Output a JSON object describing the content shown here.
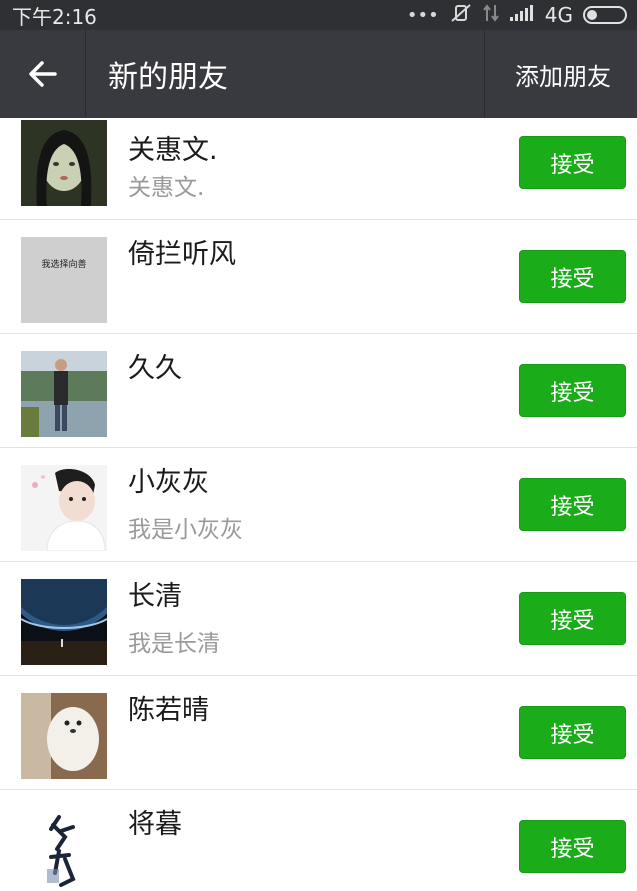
{
  "status_bar": {
    "time": "下午2:16",
    "network": "4G",
    "icons": [
      "dots-icon",
      "mute-vibrate-icon",
      "data-arrows-icon",
      "signal-icon",
      "battery-icon"
    ]
  },
  "nav": {
    "title": "新的朋友",
    "action": "添加朋友",
    "back_icon": "back-arrow-icon"
  },
  "colors": {
    "nav_bg": "#393a3f",
    "status_bg": "#2f3033",
    "accept_green": "#1aad19"
  },
  "requests": [
    {
      "name": "关惠文.",
      "message": "关惠文.",
      "button": "接受",
      "avatar": "avatar-portrait-girl"
    },
    {
      "name": "倚拦听风",
      "message": "",
      "button": "接受",
      "avatar": "avatar-gray-text",
      "avatar_text": "我选择向善"
    },
    {
      "name": "久久",
      "message": "",
      "button": "接受",
      "avatar": "avatar-person-outdoor"
    },
    {
      "name": "小灰灰",
      "message": "我是小灰灰",
      "button": "接受",
      "avatar": "avatar-boy-cartoon"
    },
    {
      "name": "长清",
      "message": "我是长清",
      "button": "接受",
      "avatar": "avatar-earth-space"
    },
    {
      "name": "陈若晴",
      "message": "",
      "button": "接受",
      "avatar": "avatar-white-dog"
    },
    {
      "name": "将暮",
      "message": "",
      "button": "接受",
      "avatar": "avatar-calligraphy"
    }
  ]
}
